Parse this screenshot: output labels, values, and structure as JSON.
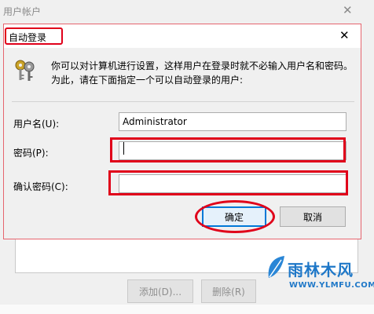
{
  "background_window": {
    "title": "用户帐户",
    "add_button": "添加(D)...",
    "delete_button": "删除(R)"
  },
  "dialog": {
    "title": "自动登录",
    "description": "你可以对计算机进行设置，这样用户在登录时就不必输入用户名和密码。为此，请在下面指定一个可以自动登录的用户:",
    "username_label": "用户名(U):",
    "username_value": "Administrator",
    "password_label": "密码(P):",
    "password_value": "",
    "confirm_label": "确认密码(C):",
    "confirm_value": "",
    "ok_label": "确定",
    "cancel_label": "取消"
  },
  "watermark": {
    "text": "雨林木风",
    "url": "WWW.YLMFU.COM"
  },
  "colors": {
    "annotation_red": "#e0001a",
    "focus_blue": "#0078d7",
    "watermark_blue": "#1f78c8"
  }
}
